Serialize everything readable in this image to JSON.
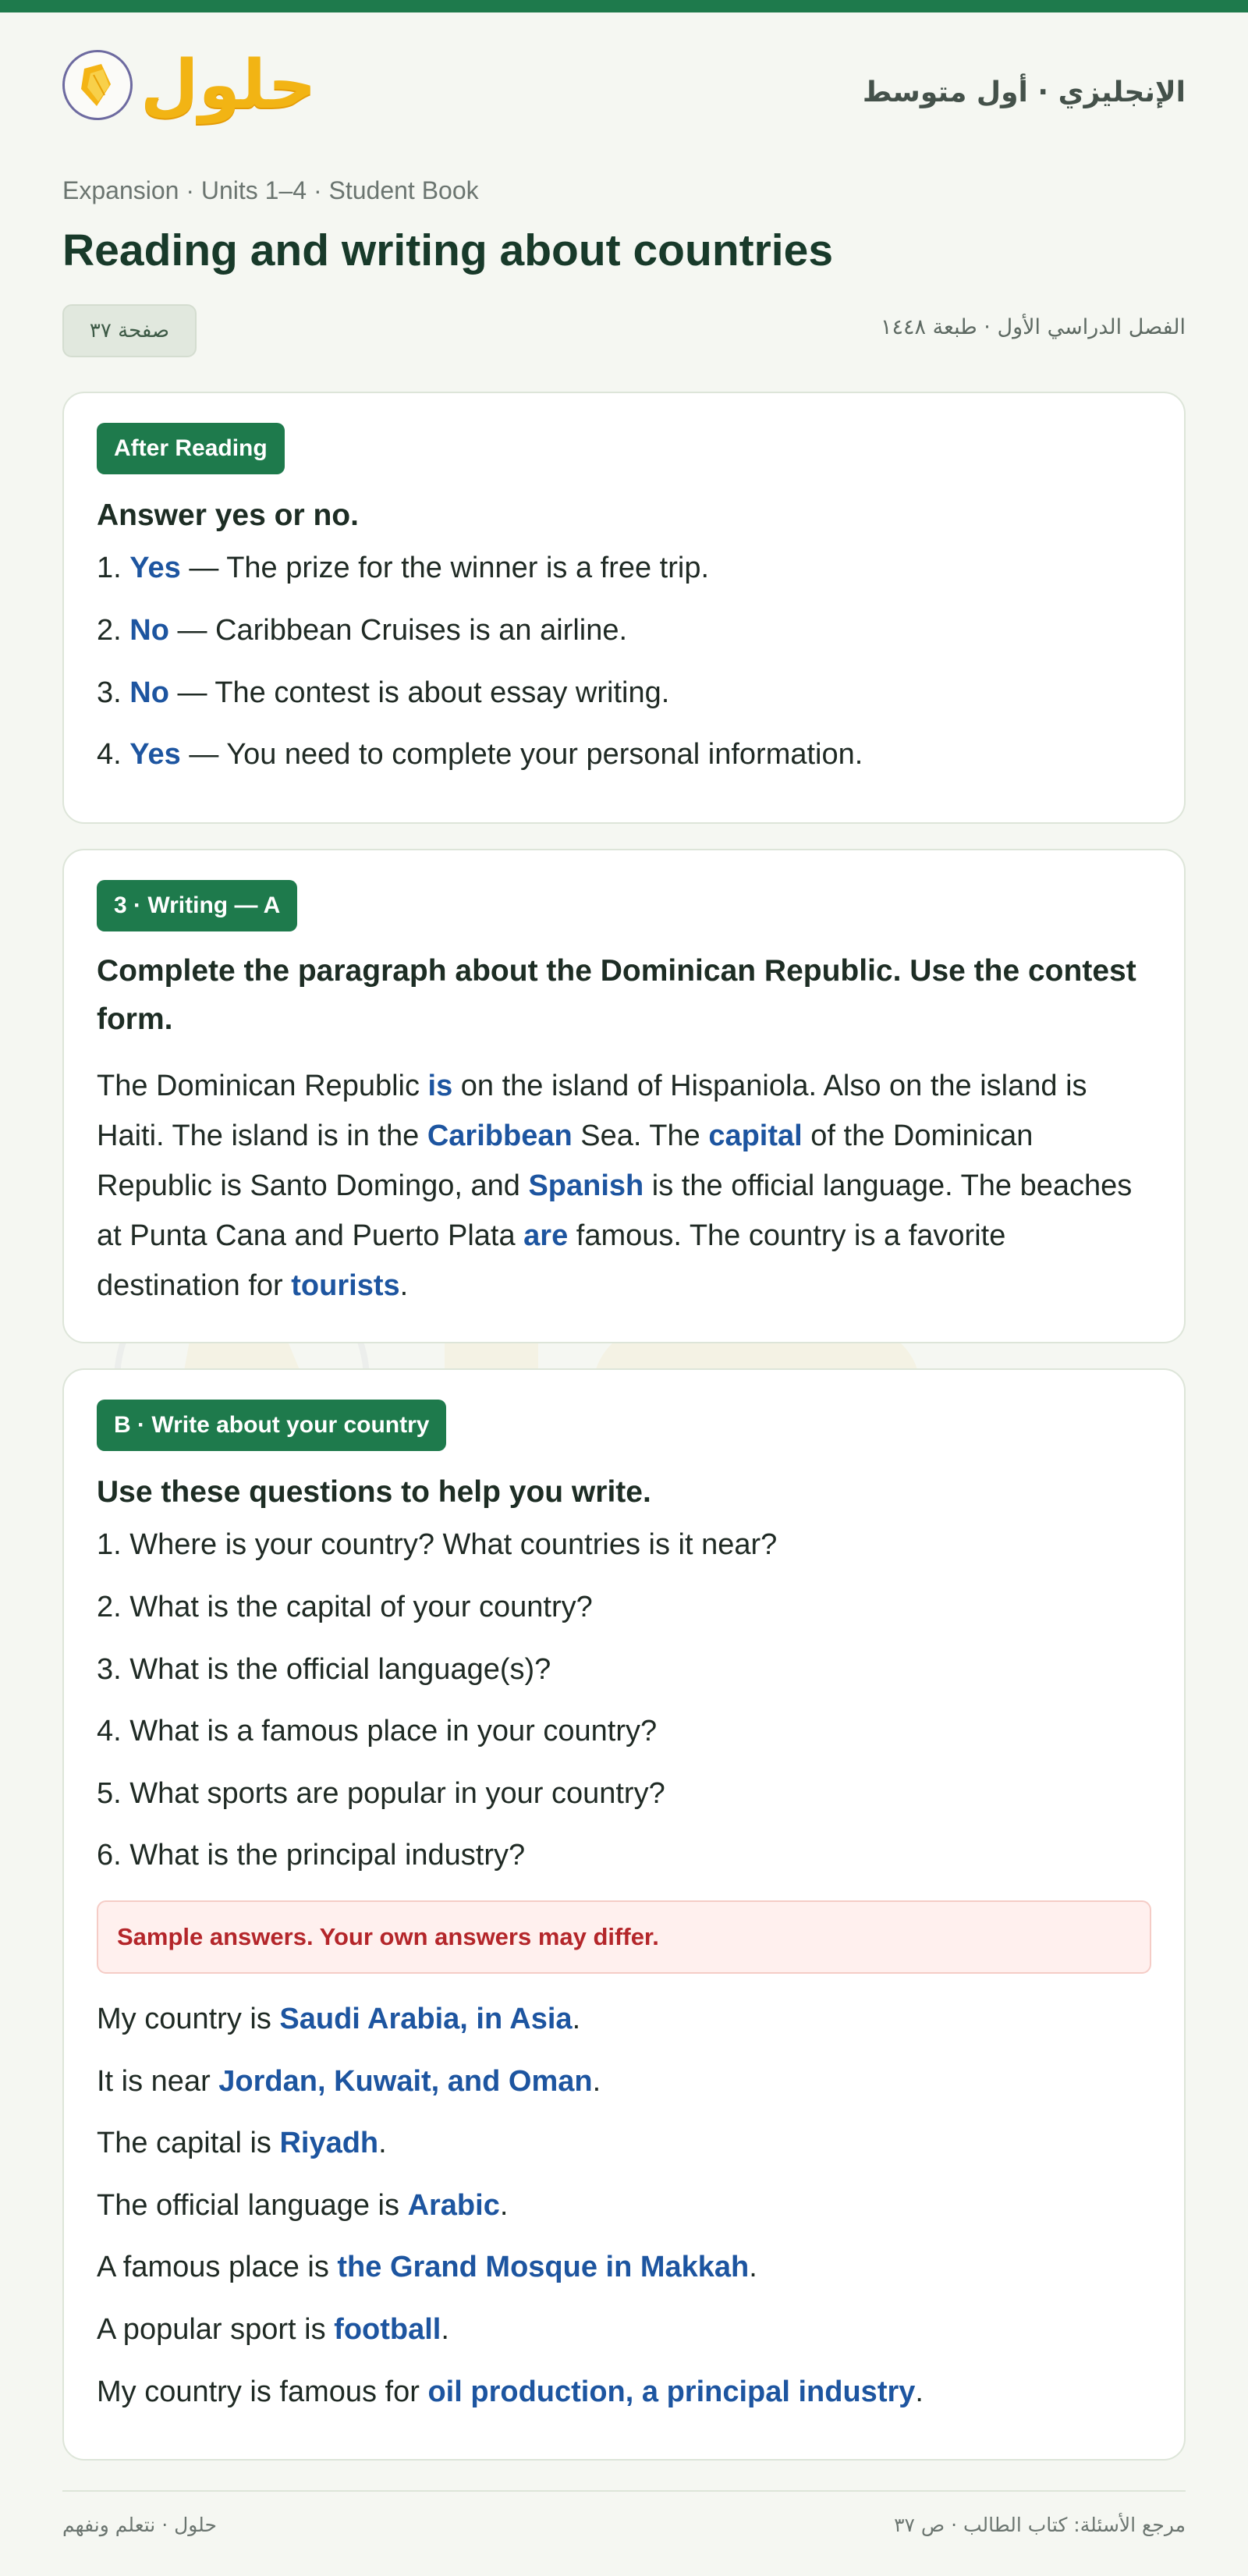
{
  "header": {
    "logo_text": "حلول",
    "subject": "الإنجليزي · أول متوسط",
    "breadcrumb": "Expansion · Units 1–4 · Student Book",
    "title": "Reading and writing about countries",
    "page_badge": "صفحة ٣٧",
    "edition": "الفصل الدراسي الأول · طبعة ١٤٤٨"
  },
  "after_reading": {
    "pill": "After Reading",
    "heading": "Answer yes or no.",
    "items": [
      {
        "num": "1.",
        "answer": "Yes",
        "text": " — The prize for the winner is a free trip."
      },
      {
        "num": "2.",
        "answer": "No",
        "text": " — Caribbean Cruises is an airline."
      },
      {
        "num": "3.",
        "answer": "No",
        "text": " — The contest is about essay writing."
      },
      {
        "num": "4.",
        "answer": "Yes",
        "text": " — You need to complete your personal information."
      }
    ]
  },
  "writing_a": {
    "pill": "3 · Writing — A",
    "heading": "Complete the paragraph about the Dominican Republic. Use the contest form.",
    "parts": [
      {
        "t": "The Dominican Republic "
      },
      {
        "a": "is"
      },
      {
        "t": " on the island of Hispaniola. Also on the island is Haiti. The island is in the "
      },
      {
        "a": "Caribbean"
      },
      {
        "t": " Sea. The "
      },
      {
        "a": "capital"
      },
      {
        "t": " of the Dominican Republic is Santo Domingo, and "
      },
      {
        "a": "Spanish"
      },
      {
        "t": " is the official language. The beaches at Punta Cana and Puerto Plata "
      },
      {
        "a": "are"
      },
      {
        "t": " famous. The country is a favorite destination for "
      },
      {
        "a": "tourists"
      },
      {
        "t": "."
      }
    ]
  },
  "writing_b": {
    "pill": "B · Write about your country",
    "heading": "Use these questions to help you write.",
    "questions": [
      "1. Where is your country? What countries is it near?",
      "2. What is the capital of your country?",
      "3. What is the official language(s)?",
      "4. What is a famous place in your country?",
      "5. What sports are popular in your country?",
      "6. What is the principal industry?"
    ],
    "note": "Sample answers. Your own answers may differ.",
    "answers": [
      {
        "pre": "My country is ",
        "ans": "Saudi Arabia, in Asia",
        "post": "."
      },
      {
        "pre": "It is near ",
        "ans": "Jordan, Kuwait, and Oman",
        "post": "."
      },
      {
        "pre": "The capital is ",
        "ans": "Riyadh",
        "post": "."
      },
      {
        "pre": "The official language is ",
        "ans": "Arabic",
        "post": "."
      },
      {
        "pre": "A famous place is ",
        "ans": "the Grand Mosque in Makkah",
        "post": "."
      },
      {
        "pre": "A popular sport is ",
        "ans": "football",
        "post": "."
      },
      {
        "pre": "My country is famous for ",
        "ans": "oil production, a principal industry",
        "post": "."
      }
    ]
  },
  "footer": {
    "left": "حلول · نتعلم ونفهم",
    "right": "مرجع الأسئلة: كتاب الطالب · ص ٣٧"
  },
  "colors": {
    "brand_green": "#1e7a4c",
    "answer_blue": "#1d55a0",
    "note_red": "#b4262a",
    "logo_gold": "#f2b414"
  }
}
